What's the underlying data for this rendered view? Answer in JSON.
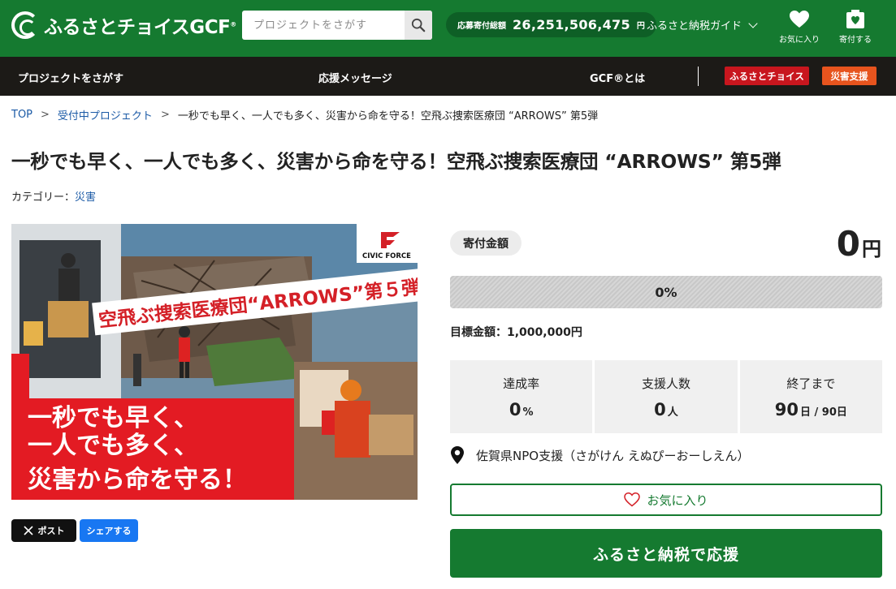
{
  "header": {
    "logo_text": "ふるさとチョイスGCF",
    "logo_mark": "®",
    "search_placeholder": "プロジェクトをさがす",
    "total_label": "応募寄付総額",
    "total_value": "26,251,506,475",
    "total_unit": "円",
    "guide_label": "ふるさと納税ガイド",
    "favorites_label": "お気に入り",
    "donate_label": "寄付する",
    "brand_color": "#157a30"
  },
  "nav": {
    "items": [
      "プロジェクトをさがす",
      "応援メッセージ",
      "GCF®とは"
    ],
    "badge_choice": "ふるさとチョイス",
    "badge_disaster": "災害支援",
    "badge_choice_color": "#c8161e",
    "badge_disaster_color": "#e7541e"
  },
  "breadcrumb": {
    "top": "TOP",
    "list": "受付中プロジェクト",
    "current": "一秒でも早く、一人でも多く、災害から命を守る！空飛ぶ捜索医療団 “ARROWS” 第5弾"
  },
  "project": {
    "title": "一秒でも早く、一人でも多く、災害から命を守る！空飛ぶ捜索医療団 “ARROWS” 第5弾",
    "category_label": "カテゴリー：",
    "category_value": "災害",
    "hero": {
      "org_logo_text": "CIVIC FORCE",
      "banner_text": "空飛ぶ捜索医療団“ARROWS”第５弾",
      "slogan_lines": [
        "一秒でも早く、",
        "一人でも多く、",
        "災害から命を守る！"
      ]
    },
    "share_x_label": "ポスト",
    "share_fb_label": "シェアする"
  },
  "funding": {
    "amount_label": "寄付金額",
    "amount_value": "0",
    "amount_unit": "円",
    "progress_percent": 0,
    "progress_text": "0%",
    "goal_text": "目標金額：1,000,000円",
    "stats": [
      {
        "label": "達成率",
        "value": "0",
        "unit": "%"
      },
      {
        "label": "支援人数",
        "value": "0",
        "unit": "人"
      },
      {
        "label": "終了まで",
        "value": "90",
        "unit": "日 / 90日"
      }
    ],
    "organization": "佐賀県NPO支援（さがけん えぬぴーおーしえん）",
    "favorite_button": "お気に入り",
    "donate_button": "ふるさと納税で応援"
  }
}
